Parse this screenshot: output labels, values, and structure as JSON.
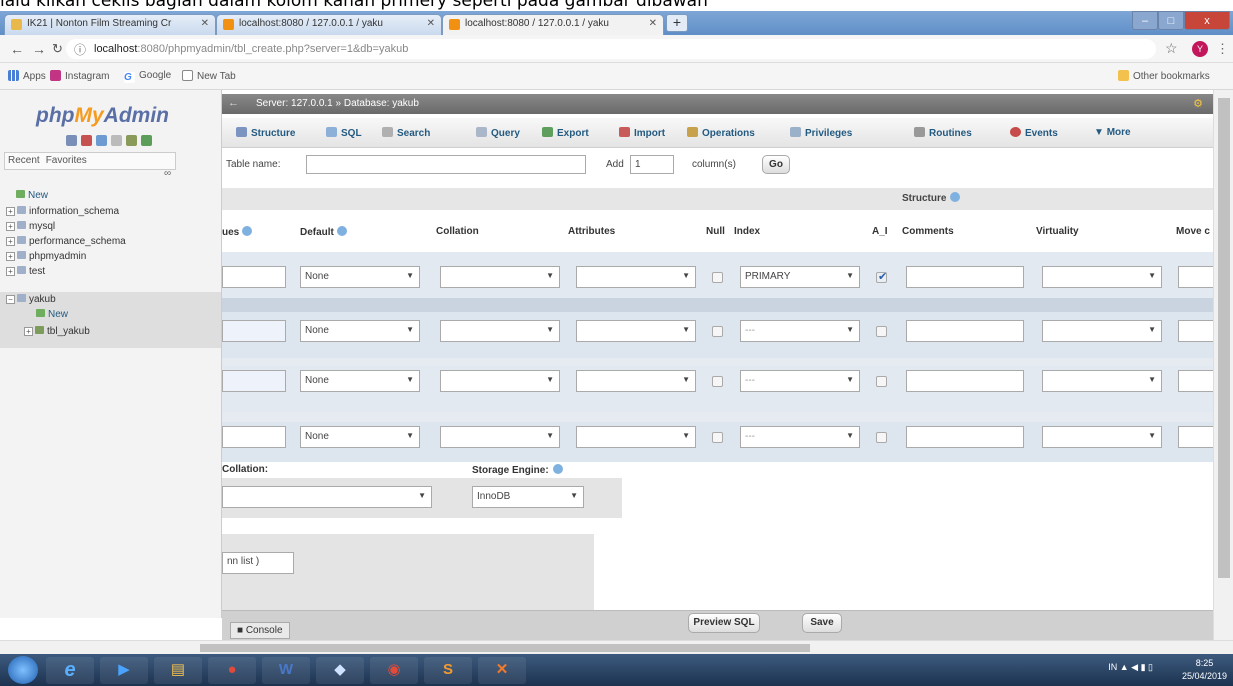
{
  "caption": "lalu klikan ceklis bagian dalam kolom kanan primery seperti pada gambar dibawah",
  "browser": {
    "tabs": [
      {
        "title": "IK21 | Nonton Film Streaming Cr",
        "color": "#e8b84a"
      },
      {
        "title": "localhost:8080 / 127.0.0.1 / yaku",
        "color": "#f29111"
      },
      {
        "title": "localhost:8080 / 127.0.0.1 / yaku",
        "color": "#f29111"
      }
    ],
    "new_tab": "+",
    "window_buttons": [
      "–",
      "□",
      "x"
    ],
    "url_host": "localhost",
    "url_rest": ":8080/phpmyadmin/tbl_create.php?server=1&db=yakub",
    "profile_initial": "Y",
    "bookmarks": {
      "apps": "Apps",
      "instagram": "Instagram",
      "google": "Google",
      "newtab": "New Tab",
      "other": "Other bookmarks"
    }
  },
  "nav": {
    "logo_php": "php",
    "logo_my": "My",
    "logo_admin": "Admin",
    "recent": "Recent",
    "favorites": "Favorites",
    "collapse": "∞",
    "tree": [
      {
        "label": "New",
        "type": "new"
      },
      {
        "label": "information_schema",
        "type": "db"
      },
      {
        "label": "mysql",
        "type": "db"
      },
      {
        "label": "performance_schema",
        "type": "db"
      },
      {
        "label": "phpmyadmin",
        "type": "db"
      },
      {
        "label": "test",
        "type": "db"
      },
      {
        "label": "yakub",
        "type": "db"
      },
      {
        "label": "New",
        "type": "new"
      },
      {
        "label": "tbl_yakub",
        "type": "table"
      }
    ]
  },
  "main": {
    "breadcrumb_server": "Server: 127.0.0.1",
    "breadcrumb_db": "Database: yakub",
    "tabs": [
      "Structure",
      "SQL",
      "Search",
      "Query",
      "Export",
      "Import",
      "Operations",
      "Privileges",
      "Routines",
      "Events",
      "More"
    ],
    "table_name_label": "Table name:",
    "table_name_value": "",
    "add_label": "Add",
    "add_value": "1",
    "columns_label": "column(s)",
    "go_label": "Go",
    "structure_label": "Structure",
    "headers": {
      "values": "ues",
      "default": "Default",
      "collation": "Collation",
      "attributes": "Attributes",
      "null": "Null",
      "index": "Index",
      "ai": "A_I",
      "comments": "Comments",
      "virtuality": "Virtuality",
      "move": "Move c"
    },
    "rows": [
      {
        "default": "None",
        "index": "PRIMARY",
        "ai_checked": true
      },
      {
        "default": "None",
        "index": "---",
        "ai_checked": false
      },
      {
        "default": "None",
        "index": "---",
        "ai_checked": false
      },
      {
        "default": "None",
        "index": "---",
        "ai_checked": false
      }
    ],
    "collation_label": "Collation:",
    "storage_engine_label": "Storage Engine:",
    "storage_engine_value": "InnoDB",
    "partition_text": "nn list",
    "partition_paren": ")",
    "console_label": "Console",
    "preview_sql": "Preview SQL",
    "save": "Save"
  },
  "taskbar": {
    "lang": "IN",
    "time": "8:25",
    "date": "25/04/2019"
  }
}
